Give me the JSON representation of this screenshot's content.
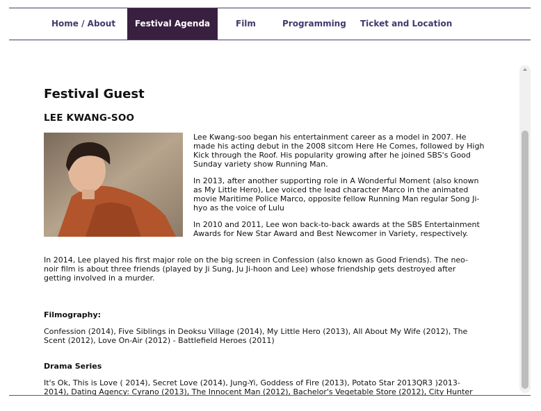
{
  "nav": {
    "items": [
      "Home / About",
      "Festival Agenda",
      "Film",
      "Programming",
      "Ticket and Location"
    ],
    "active": "Festival Agenda"
  },
  "page": {
    "title": "Festival Guest",
    "guest_name": "LEE KWANG-SOO",
    "bio": [
      "Lee Kwang-soo began his entertainment career as a model in 2007. He made his acting debut in the 2008 sitcom Here He Comes, followed by High Kick through the Roof. His popularity growing after he joined SBS's Good Sunday variety show Running Man.",
      "In 2013, after another supporting role in A Wonderful Moment (also known as My Little Hero), Lee voiced the lead character Marco in the animated movie Maritime Police Marco, opposite fellow Running Man regular Song Ji-hyo as the voice of Lulu",
      "In 2010 and 2011, Lee won back-to-back awards at the SBS Entertainment Awards for New Star Award and Best Newcomer in Variety, respectively."
    ],
    "bio_wide": "In 2014, Lee played his first major role on the big screen in Confession (also known as Good Friends). The neo-noir film is about three friends (played by Ji Sung, Ju Ji-hoon and Lee) whose friendship gets destroyed after getting involved in a murder.",
    "filmography_heading": "Filmography:",
    "filmography": "Confession (2014), Five Siblings in Deoksu Village (2014), My Little Hero (2013), All About My Wife (2012), The Scent (2012), Love On-Air (2012) - Battlefield Heroes (2011)",
    "drama_heading": "Drama Series",
    "drama": "It's Ok, This is Love ( 2014), Secret Love (2014), Jung-Yi, Goddess of Fire (2013), Potato Star 2013QR3 )2013-2014), Dating Agency: Cyrano (2013), The Innocent Man (2012), Bachelor's Vegetable Store (2012), City Hunter"
  },
  "colors": {
    "nav_active_bg": "#3a2040",
    "nav_text": "#3e3a6c",
    "rule": "#4a3a5e"
  }
}
